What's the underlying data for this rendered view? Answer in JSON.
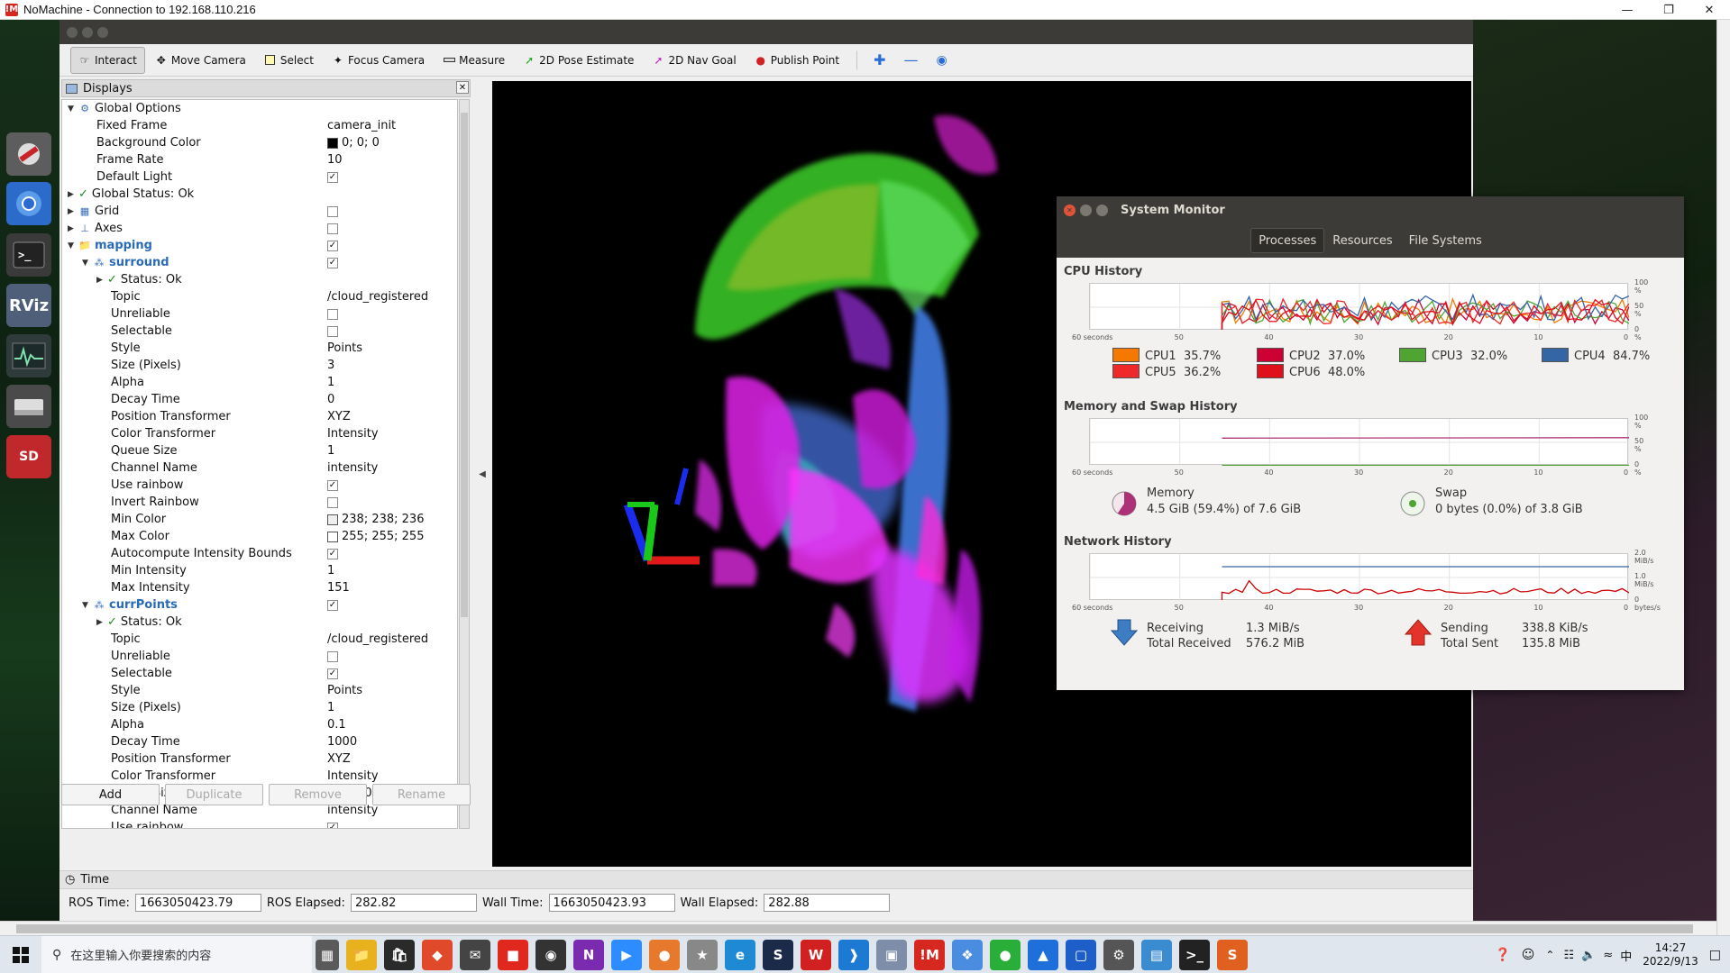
{
  "window": {
    "title": "NoMachine - Connection to 192.168.110.216"
  },
  "toolbar": {
    "tools": [
      {
        "label": "Interact",
        "icon": "hand-icon",
        "active": true
      },
      {
        "label": "Move Camera",
        "icon": "move-camera-icon"
      },
      {
        "label": "Select",
        "icon": "select-icon"
      },
      {
        "label": "Focus Camera",
        "icon": "focus-camera-icon"
      },
      {
        "label": "Measure",
        "icon": "measure-icon"
      },
      {
        "label": "2D Pose Estimate",
        "icon": "pose-estimate-icon"
      },
      {
        "label": "2D Nav Goal",
        "icon": "nav-goal-icon"
      },
      {
        "label": "Publish Point",
        "icon": "publish-point-icon"
      }
    ]
  },
  "displays": {
    "title": "Displays",
    "rows": [
      {
        "key": "Global Options",
        "indent": 0,
        "arrow": "open",
        "icon": "gear",
        "value": ""
      },
      {
        "key": "Fixed Frame",
        "indent": 1,
        "value": "camera_init"
      },
      {
        "key": "Background Color",
        "indent": 1,
        "value": "0; 0; 0",
        "swatch": "#000000"
      },
      {
        "key": "Frame Rate",
        "indent": 1,
        "value": "10"
      },
      {
        "key": "Default Light",
        "indent": 1,
        "check": true
      },
      {
        "key": "Global Status: Ok",
        "indent": 0,
        "arrow": "closed",
        "status": true
      },
      {
        "key": "Grid",
        "indent": 0,
        "arrow": "closed",
        "icon": "grid",
        "check": false
      },
      {
        "key": "Axes",
        "indent": 0,
        "arrow": "closed",
        "icon": "axes",
        "check": false
      },
      {
        "key": "mapping",
        "indent": 0,
        "arrow": "open",
        "icon": "folder",
        "check": true,
        "bold": true
      },
      {
        "key": "surround",
        "indent": 1,
        "arrow": "open",
        "icon": "cloud",
        "check": true,
        "bold": true
      },
      {
        "key": "Status: Ok",
        "indent": 2,
        "arrow": "closed",
        "status": true
      },
      {
        "key": "Topic",
        "indent": 2,
        "value": "/cloud_registered"
      },
      {
        "key": "Unreliable",
        "indent": 2,
        "check": false
      },
      {
        "key": "Selectable",
        "indent": 2,
        "check": false
      },
      {
        "key": "Style",
        "indent": 2,
        "value": "Points"
      },
      {
        "key": "Size (Pixels)",
        "indent": 2,
        "value": "3"
      },
      {
        "key": "Alpha",
        "indent": 2,
        "value": "1"
      },
      {
        "key": "Decay Time",
        "indent": 2,
        "value": "0"
      },
      {
        "key": "Position Transformer",
        "indent": 2,
        "value": "XYZ"
      },
      {
        "key": "Color Transformer",
        "indent": 2,
        "value": "Intensity"
      },
      {
        "key": "Queue Size",
        "indent": 2,
        "value": "1"
      },
      {
        "key": "Channel Name",
        "indent": 2,
        "value": "intensity"
      },
      {
        "key": "Use rainbow",
        "indent": 2,
        "check": true
      },
      {
        "key": "Invert Rainbow",
        "indent": 2,
        "check": false
      },
      {
        "key": "Min Color",
        "indent": 2,
        "value": "238; 238; 236",
        "swatch": "#eeeeec"
      },
      {
        "key": "Max Color",
        "indent": 2,
        "value": "255; 255; 255",
        "swatch": "#ffffff"
      },
      {
        "key": "Autocompute Intensity Bounds",
        "indent": 2,
        "check": true
      },
      {
        "key": "Min Intensity",
        "indent": 2,
        "value": "1"
      },
      {
        "key": "Max Intensity",
        "indent": 2,
        "value": "151"
      },
      {
        "key": "currPoints",
        "indent": 1,
        "arrow": "open",
        "icon": "cloud",
        "check": true,
        "bold": true
      },
      {
        "key": "Status: Ok",
        "indent": 2,
        "arrow": "closed",
        "status": true
      },
      {
        "key": "Topic",
        "indent": 2,
        "value": "/cloud_registered"
      },
      {
        "key": "Unreliable",
        "indent": 2,
        "check": false
      },
      {
        "key": "Selectable",
        "indent": 2,
        "check": true
      },
      {
        "key": "Style",
        "indent": 2,
        "value": "Points"
      },
      {
        "key": "Size (Pixels)",
        "indent": 2,
        "value": "1"
      },
      {
        "key": "Alpha",
        "indent": 2,
        "value": "0.1"
      },
      {
        "key": "Decay Time",
        "indent": 2,
        "value": "1000"
      },
      {
        "key": "Position Transformer",
        "indent": 2,
        "value": "XYZ"
      },
      {
        "key": "Color Transformer",
        "indent": 2,
        "value": "Intensity"
      },
      {
        "key": "Queue Size",
        "indent": 2,
        "value": "100000"
      },
      {
        "key": "Channel Name",
        "indent": 2,
        "value": "intensity"
      },
      {
        "key": "Use rainbow",
        "indent": 2,
        "check": true
      }
    ],
    "buttons": {
      "add": "Add",
      "duplicate": "Duplicate",
      "remove": "Remove",
      "rename": "Rename"
    }
  },
  "time": {
    "title": "Time",
    "ros_time_label": "ROS Time:",
    "ros_time": "1663050423.79",
    "ros_elapsed_label": "ROS Elapsed:",
    "ros_elapsed": "282.82",
    "wall_time_label": "Wall Time:",
    "wall_time": "1663050423.93",
    "wall_elapsed_label": "Wall Elapsed:",
    "wall_elapsed": "282.88"
  },
  "system_monitor": {
    "title": "System Monitor",
    "tabs": [
      "Processes",
      "Resources",
      "File Systems"
    ],
    "selected_tab": "Resources",
    "cpu_history_title": "CPU History",
    "memory_history_title": "Memory and Swap History",
    "network_history_title": "Network History",
    "x_ticks": [
      "60 seconds",
      "50",
      "40",
      "30",
      "20",
      "10",
      "0"
    ],
    "percent_ticks": [
      "100 %",
      "50 %",
      "0 %"
    ],
    "net_ticks": [
      "2.0 MiB/s",
      "1.0 MiB/s",
      "0 bytes/s"
    ],
    "cpus": [
      {
        "label": "CPU1",
        "value": "35.7%",
        "color": "#f57900"
      },
      {
        "label": "CPU2",
        "value": "37.0%",
        "color": "#cc0033"
      },
      {
        "label": "CPU3",
        "value": "32.0%",
        "color": "#4ea532"
      },
      {
        "label": "CPU4",
        "value": "84.7%",
        "color": "#3465a4"
      },
      {
        "label": "CPU5",
        "value": "36.2%",
        "color": "#ef2929"
      },
      {
        "label": "CPU6",
        "value": "48.0%",
        "color": "#e0101a"
      }
    ],
    "memory": {
      "label": "Memory",
      "value": "4.5 GiB (59.4%) of 7.6 GiB",
      "fraction": 0.594,
      "color": "#ad3176"
    },
    "swap": {
      "label": "Swap",
      "value": "0 bytes (0.0%) of 3.8 GiB",
      "fraction": 0.0,
      "color": "#4ea532"
    },
    "network": {
      "receiving_label": "Receiving",
      "receiving": "1.3 MiB/s",
      "total_received_label": "Total Received",
      "total_received": "576.2 MiB",
      "sending_label": "Sending",
      "sending": "338.8 KiB/s",
      "total_sent_label": "Total Sent",
      "total_sent": "135.8 MiB"
    }
  },
  "taskbar": {
    "search_placeholder": "在这里输入你要搜索的内容",
    "time": "14:27",
    "date": "2022/9/13"
  }
}
